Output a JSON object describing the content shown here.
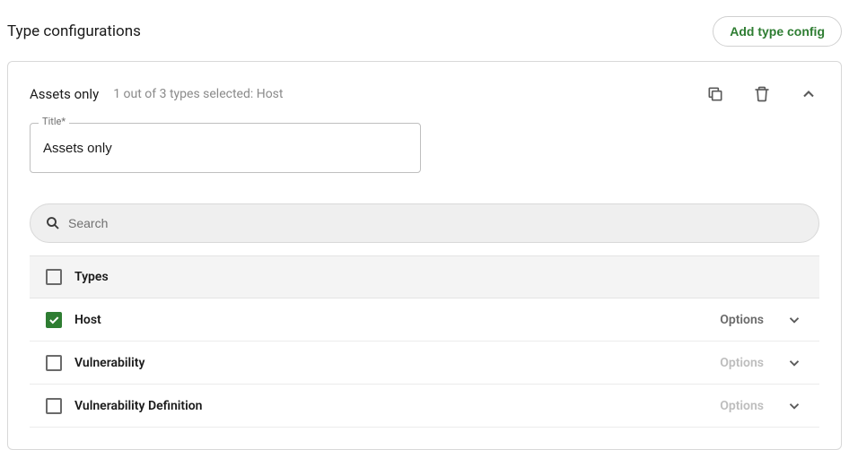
{
  "page": {
    "title": "Type configurations",
    "add_button_label": "Add type config"
  },
  "config": {
    "title": "Assets only",
    "summary": "1 out of 3 types selected: Host",
    "title_field": {
      "label": "Title*",
      "value": "Assets only"
    },
    "search": {
      "placeholder": "Search"
    },
    "table": {
      "header": "Types",
      "options_label": "Options",
      "rows": [
        {
          "label": "Host",
          "checked": true,
          "options_enabled": true
        },
        {
          "label": "Vulnerability",
          "checked": false,
          "options_enabled": false
        },
        {
          "label": "Vulnerability Definition",
          "checked": false,
          "options_enabled": false
        }
      ]
    }
  }
}
